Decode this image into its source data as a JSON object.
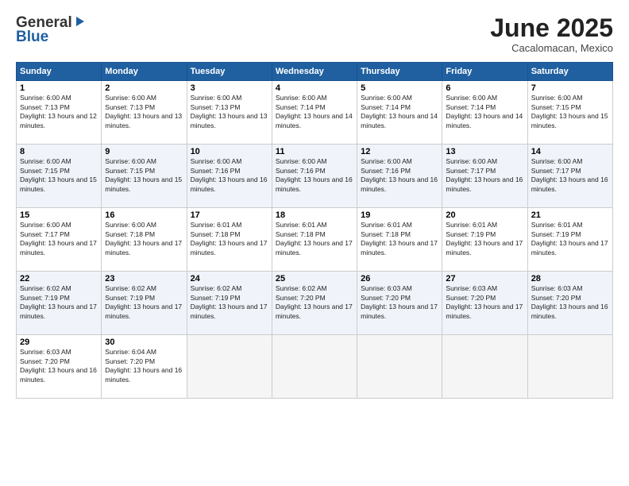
{
  "logo": {
    "line1": "General",
    "line2": "Blue"
  },
  "header": {
    "month": "June 2025",
    "location": "Cacalomacan, Mexico"
  },
  "weekdays": [
    "Sunday",
    "Monday",
    "Tuesday",
    "Wednesday",
    "Thursday",
    "Friday",
    "Saturday"
  ],
  "weeks": [
    [
      {
        "day": "1",
        "sunrise": "6:00 AM",
        "sunset": "7:13 PM",
        "daylight": "13 hours and 12 minutes."
      },
      {
        "day": "2",
        "sunrise": "6:00 AM",
        "sunset": "7:13 PM",
        "daylight": "13 hours and 13 minutes."
      },
      {
        "day": "3",
        "sunrise": "6:00 AM",
        "sunset": "7:13 PM",
        "daylight": "13 hours and 13 minutes."
      },
      {
        "day": "4",
        "sunrise": "6:00 AM",
        "sunset": "7:14 PM",
        "daylight": "13 hours and 14 minutes."
      },
      {
        "day": "5",
        "sunrise": "6:00 AM",
        "sunset": "7:14 PM",
        "daylight": "13 hours and 14 minutes."
      },
      {
        "day": "6",
        "sunrise": "6:00 AM",
        "sunset": "7:14 PM",
        "daylight": "13 hours and 14 minutes."
      },
      {
        "day": "7",
        "sunrise": "6:00 AM",
        "sunset": "7:15 PM",
        "daylight": "13 hours and 15 minutes."
      }
    ],
    [
      {
        "day": "8",
        "sunrise": "6:00 AM",
        "sunset": "7:15 PM",
        "daylight": "13 hours and 15 minutes."
      },
      {
        "day": "9",
        "sunrise": "6:00 AM",
        "sunset": "7:15 PM",
        "daylight": "13 hours and 15 minutes."
      },
      {
        "day": "10",
        "sunrise": "6:00 AM",
        "sunset": "7:16 PM",
        "daylight": "13 hours and 16 minutes."
      },
      {
        "day": "11",
        "sunrise": "6:00 AM",
        "sunset": "7:16 PM",
        "daylight": "13 hours and 16 minutes."
      },
      {
        "day": "12",
        "sunrise": "6:00 AM",
        "sunset": "7:16 PM",
        "daylight": "13 hours and 16 minutes."
      },
      {
        "day": "13",
        "sunrise": "6:00 AM",
        "sunset": "7:17 PM",
        "daylight": "13 hours and 16 minutes."
      },
      {
        "day": "14",
        "sunrise": "6:00 AM",
        "sunset": "7:17 PM",
        "daylight": "13 hours and 16 minutes."
      }
    ],
    [
      {
        "day": "15",
        "sunrise": "6:00 AM",
        "sunset": "7:17 PM",
        "daylight": "13 hours and 17 minutes."
      },
      {
        "day": "16",
        "sunrise": "6:00 AM",
        "sunset": "7:18 PM",
        "daylight": "13 hours and 17 minutes."
      },
      {
        "day": "17",
        "sunrise": "6:01 AM",
        "sunset": "7:18 PM",
        "daylight": "13 hours and 17 minutes."
      },
      {
        "day": "18",
        "sunrise": "6:01 AM",
        "sunset": "7:18 PM",
        "daylight": "13 hours and 17 minutes."
      },
      {
        "day": "19",
        "sunrise": "6:01 AM",
        "sunset": "7:18 PM",
        "daylight": "13 hours and 17 minutes."
      },
      {
        "day": "20",
        "sunrise": "6:01 AM",
        "sunset": "7:19 PM",
        "daylight": "13 hours and 17 minutes."
      },
      {
        "day": "21",
        "sunrise": "6:01 AM",
        "sunset": "7:19 PM",
        "daylight": "13 hours and 17 minutes."
      }
    ],
    [
      {
        "day": "22",
        "sunrise": "6:02 AM",
        "sunset": "7:19 PM",
        "daylight": "13 hours and 17 minutes."
      },
      {
        "day": "23",
        "sunrise": "6:02 AM",
        "sunset": "7:19 PM",
        "daylight": "13 hours and 17 minutes."
      },
      {
        "day": "24",
        "sunrise": "6:02 AM",
        "sunset": "7:19 PM",
        "daylight": "13 hours and 17 minutes."
      },
      {
        "day": "25",
        "sunrise": "6:02 AM",
        "sunset": "7:20 PM",
        "daylight": "13 hours and 17 minutes."
      },
      {
        "day": "26",
        "sunrise": "6:03 AM",
        "sunset": "7:20 PM",
        "daylight": "13 hours and 17 minutes."
      },
      {
        "day": "27",
        "sunrise": "6:03 AM",
        "sunset": "7:20 PM",
        "daylight": "13 hours and 17 minutes."
      },
      {
        "day": "28",
        "sunrise": "6:03 AM",
        "sunset": "7:20 PM",
        "daylight": "13 hours and 16 minutes."
      }
    ],
    [
      {
        "day": "29",
        "sunrise": "6:03 AM",
        "sunset": "7:20 PM",
        "daylight": "13 hours and 16 minutes."
      },
      {
        "day": "30",
        "sunrise": "6:04 AM",
        "sunset": "7:20 PM",
        "daylight": "13 hours and 16 minutes."
      },
      null,
      null,
      null,
      null,
      null
    ]
  ]
}
